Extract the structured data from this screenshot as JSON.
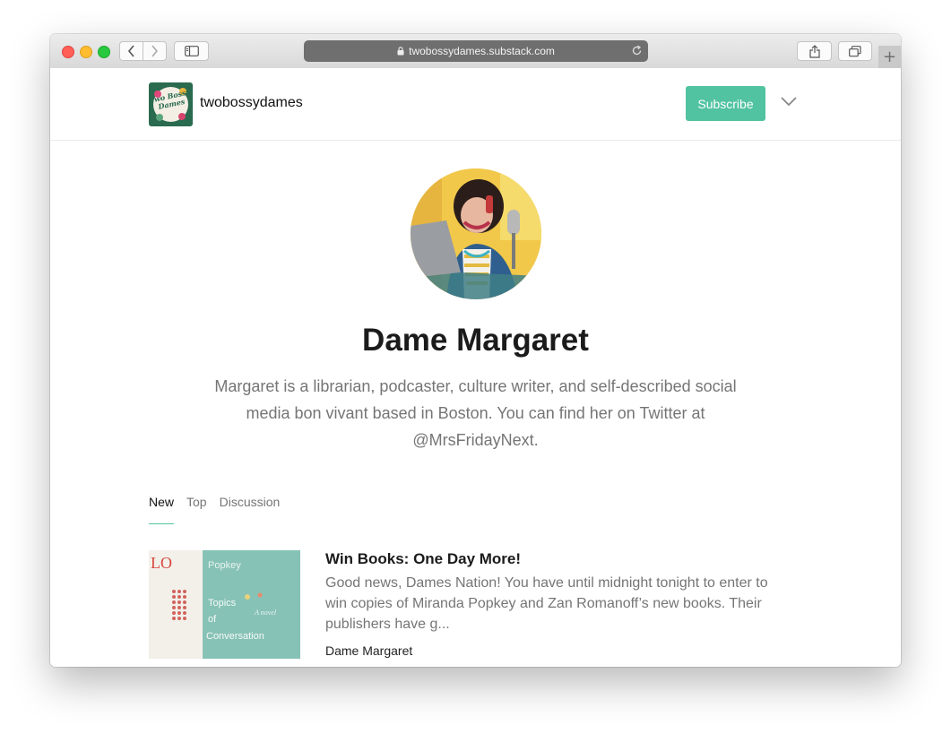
{
  "browser": {
    "url": "twobossydames.substack.com",
    "new_tab_label": "+"
  },
  "site": {
    "logo_text": "Two Bossy Dames",
    "name": "twobossydames",
    "subscribe_label": "Subscribe"
  },
  "profile": {
    "name": "Dame Margaret",
    "bio": "Margaret is a librarian, podcaster, culture writer, and self-described social media bon vivant based in Boston. You can find her on Twitter at @MrsFridayNext."
  },
  "tabs": [
    {
      "label": "New",
      "active": true
    },
    {
      "label": "Top",
      "active": false
    },
    {
      "label": "Discussion",
      "active": false
    }
  ],
  "posts": [
    {
      "title": "Win Books: One Day More!",
      "excerpt": "Good news, Dames Nation! You have until midnight tonight to enter to win copies of Miranda Popkey and Zan Romanoff’s new books. Their publishers have g...",
      "author": "Dame Margaret",
      "thumbnail_book_text": [
        "LO",
        "Popkey",
        "Topics",
        "of",
        "Conversation",
        "A novel"
      ]
    }
  ],
  "colors": {
    "accent": "#52c3a0",
    "text_primary": "#1b1b1b",
    "text_secondary": "#757575"
  }
}
